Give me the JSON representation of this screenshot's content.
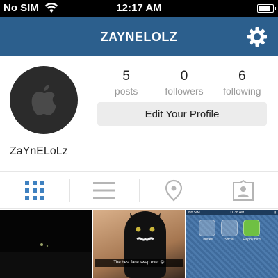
{
  "status_bar": {
    "carrier": "No SIM",
    "time": "12:17 AM",
    "battery_level": 0.9
  },
  "nav": {
    "title": "ZAYNELOLZ",
    "settings_icon": "gear-icon"
  },
  "profile": {
    "avatar_icon": "apple-logo-icon",
    "stats": [
      {
        "value": "5",
        "label": "posts"
      },
      {
        "value": "0",
        "label": "followers"
      },
      {
        "value": "6",
        "label": "following"
      }
    ],
    "edit_button_label": "Edit Your Profile",
    "display_name": "ZaYnELoLz"
  },
  "tabs": [
    {
      "icon": "grid-view-icon",
      "active": true
    },
    {
      "icon": "list-view-icon",
      "active": false
    },
    {
      "icon": "map-pin-icon",
      "active": false
    },
    {
      "icon": "tagged-person-icon",
      "active": false
    }
  ],
  "photos": {
    "photo2_caption": "The best face swap ever 😝",
    "photo3": {
      "status_carrier": "No SIM",
      "status_time": "11:38 AM",
      "folders": [
        "Utilities",
        "Social",
        "Flappy Bird"
      ]
    }
  },
  "colors": {
    "nav_background": "#2c5f8d",
    "active_tab": "#3f81c0",
    "inactive_tab": "#b5b5b5"
  }
}
